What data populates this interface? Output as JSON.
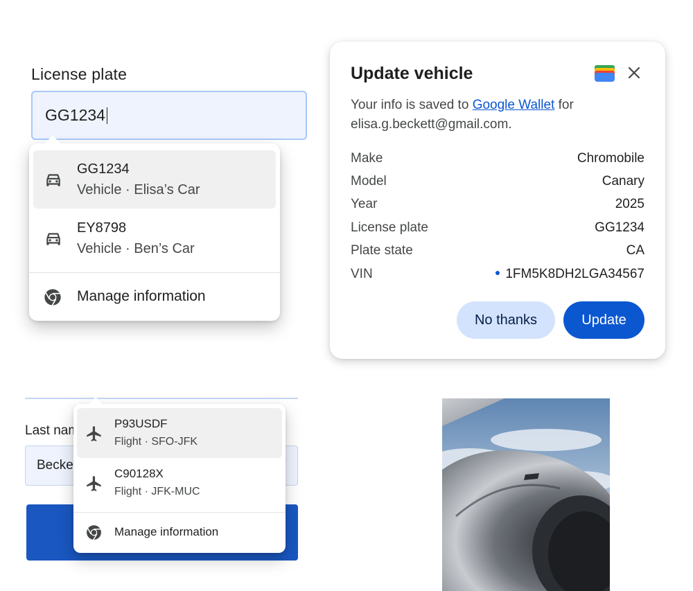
{
  "license_field": {
    "label": "License plate",
    "value": "GG1234"
  },
  "vehicle_dropdown": {
    "items": [
      {
        "title": "GG1234",
        "subtitle": "Vehicle · Elisa’s Car",
        "icon": "car-icon",
        "highlighted": true
      },
      {
        "title": "EY8798",
        "subtitle": "Vehicle · Ben’s Car",
        "icon": "car-icon",
        "highlighted": false
      }
    ],
    "manage_label": "Manage information",
    "manage_icon": "chrome-icon"
  },
  "update_card": {
    "title": "Update vehicle",
    "info_prefix": "Your info is saved to ",
    "info_link": "Google Wallet",
    "info_suffix": " for",
    "info_email": "elisa.g.beckett@gmail.com.",
    "wallet_icon": "google-wallet-icon",
    "close_icon": "close-icon",
    "rows": [
      {
        "label": "Make",
        "value": "Chromobile"
      },
      {
        "label": "Model",
        "value": "Canary"
      },
      {
        "label": "Year",
        "value": "2025"
      },
      {
        "label": "License plate",
        "value": "GG1234"
      },
      {
        "label": "Plate state",
        "value": "CA"
      },
      {
        "label": "VIN",
        "value": "1FM5K8DH2LGA34567"
      }
    ],
    "no_thanks_label": "No thanks",
    "update_label": "Update"
  },
  "last_name_field": {
    "label": "Last name",
    "value": "Beckett"
  },
  "flight_dropdown": {
    "items": [
      {
        "title": "P93USDF",
        "subtitle": "Flight · SFO-JFK",
        "icon": "airplane-icon",
        "highlighted": true
      },
      {
        "title": "C90128X",
        "subtitle": "Flight · JFK-MUC",
        "icon": "airplane-icon",
        "highlighted": false
      }
    ],
    "manage_label": "Manage information",
    "manage_icon": "chrome-icon"
  },
  "colors": {
    "accent": "#0b57d0",
    "tonal_button": "#d3e3fd",
    "input_fill": "#eef3fd",
    "input_focus_border": "#a8c7fa",
    "highlight_row": "#f0f0f0"
  }
}
